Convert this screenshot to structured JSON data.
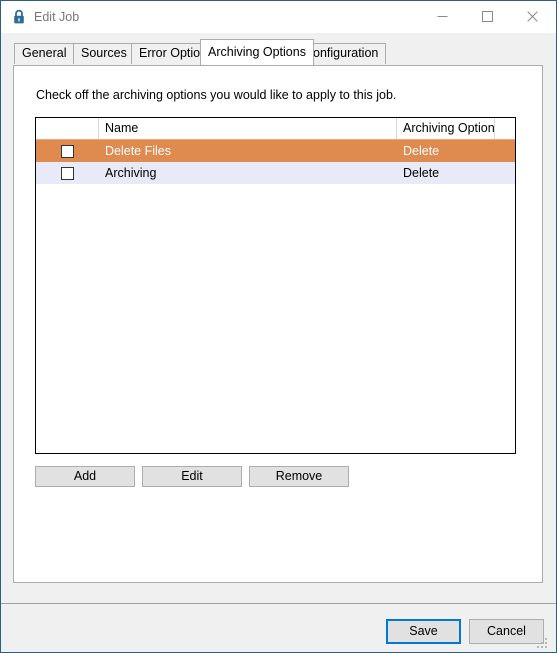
{
  "window": {
    "title": "Edit Job",
    "icon": "padlock-icon",
    "border_color": "#2b6083",
    "controls": {
      "minimize": "Minimize",
      "maximize": "Maximize",
      "close": "Close"
    }
  },
  "tabs": [
    {
      "label": "General",
      "active": false
    },
    {
      "label": "Sources",
      "active": false
    },
    {
      "label": "Error Options",
      "active": false
    },
    {
      "label": "Archiving Options",
      "active": true
    },
    {
      "label": "Configuration",
      "active": false
    }
  ],
  "panel": {
    "instruction": "Check off the archiving options you would like to apply to this job."
  },
  "grid": {
    "columns": [
      "",
      "Name",
      "Archiving Option",
      ""
    ],
    "rows": [
      {
        "checked": false,
        "name": "Delete Files",
        "option": "Delete",
        "selected": true
      },
      {
        "checked": false,
        "name": "Archiving",
        "option": "Delete",
        "selected": false
      }
    ],
    "selected_row_color": "#df8b4f",
    "alt_row_color": "#e9eaf7"
  },
  "actions": {
    "add": "Add",
    "edit": "Edit",
    "remove": "Remove"
  },
  "footer": {
    "save": "Save",
    "cancel": "Cancel",
    "focus_color": "#0078d7"
  }
}
